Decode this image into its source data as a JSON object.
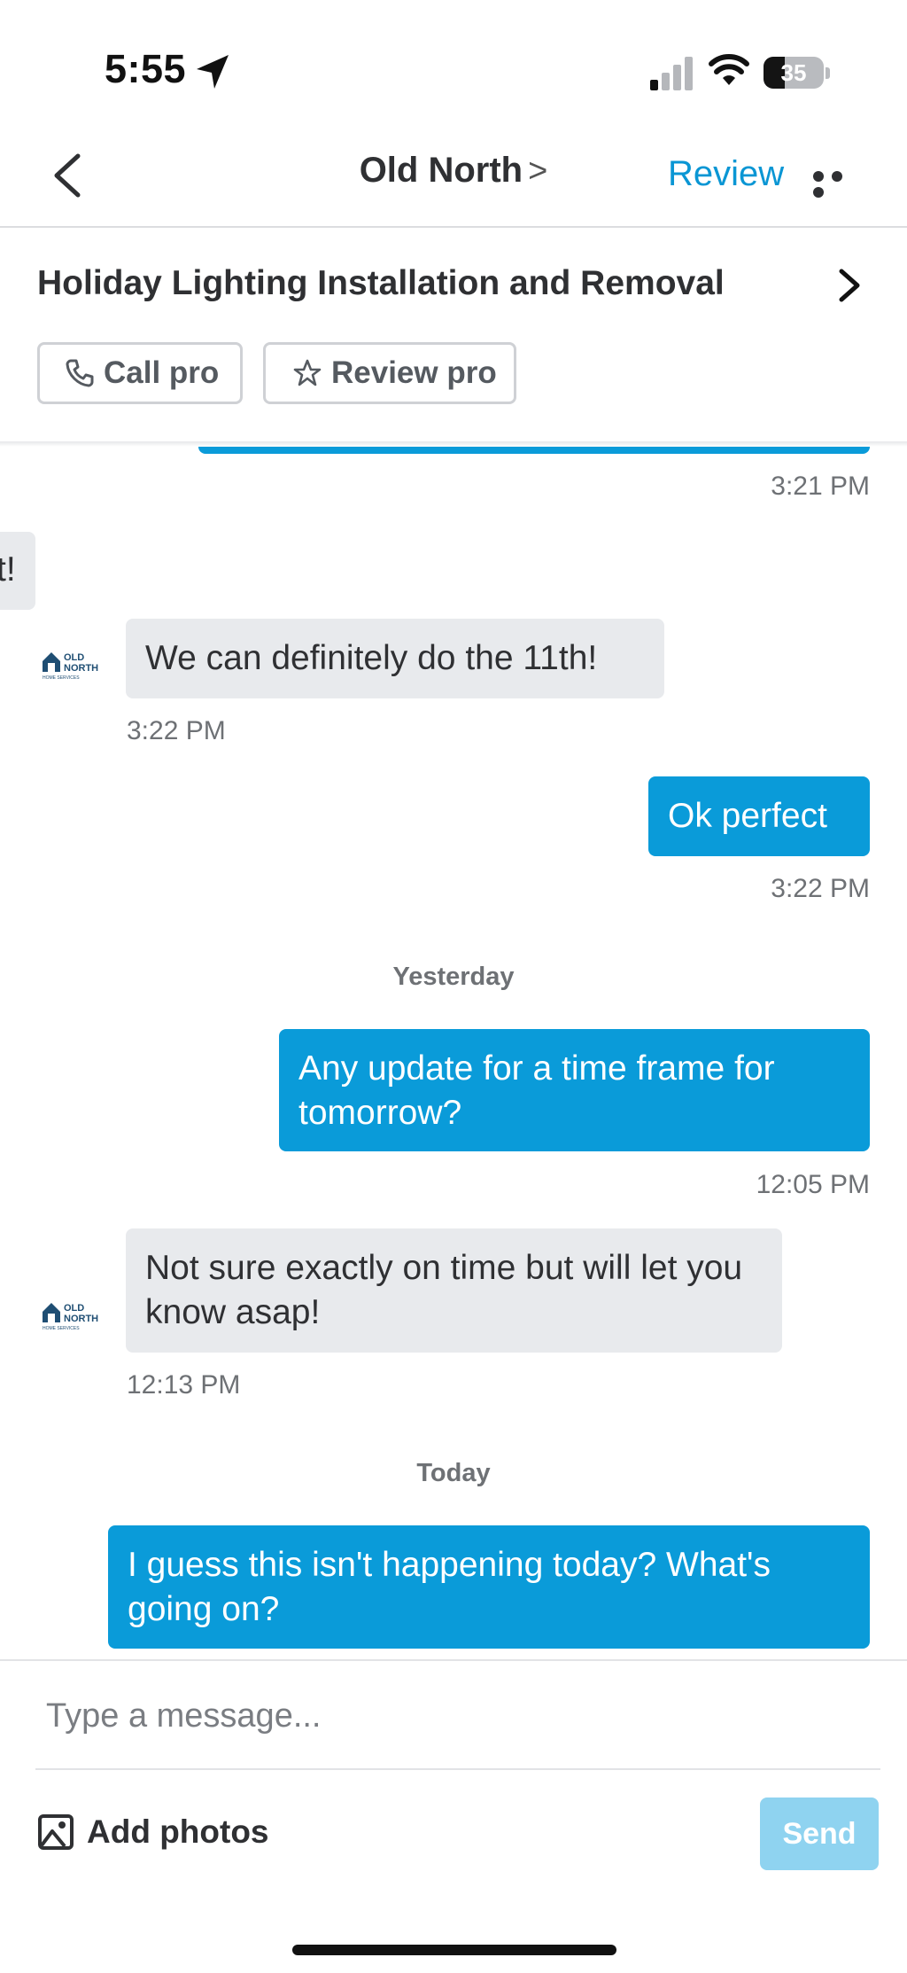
{
  "status_bar": {
    "time": "5:55",
    "battery": "35",
    "battery_level": 0.35
  },
  "header": {
    "title": "Old North",
    "title_chevron": ">",
    "review_label": "Review"
  },
  "project": {
    "title": "Holiday Lighting Installation and Removal",
    "call_label": "Call pro",
    "review_label": "Review pro"
  },
  "pro": {
    "logo_line1": "OLD",
    "logo_line2": "NORTH",
    "logo_line3": "HOME SERVICES"
  },
  "messages": [
    {
      "from": "me",
      "text": "",
      "time": "3:21 PM"
    },
    {
      "from": "pro",
      "text": "t!",
      "time": ""
    },
    {
      "from": "pro",
      "text": "We can definitely do the 11th!",
      "time": "3:22 PM"
    },
    {
      "from": "me",
      "text": "Ok perfect",
      "time": "3:22 PM"
    },
    {
      "from": "me",
      "text": "Any update for a time frame for tomorrow?",
      "time": "12:05 PM"
    },
    {
      "from": "pro",
      "text": "Not sure exactly on time but will let you know asap!",
      "time": "12:13 PM"
    },
    {
      "from": "me",
      "text": "I guess this isn't happening today? What's going on?",
      "time": ""
    }
  ],
  "day_separators": [
    "Yesterday",
    "Today"
  ],
  "composer": {
    "placeholder": "Type a message...",
    "add_photos_label": "Add photos",
    "send_label": "Send"
  }
}
